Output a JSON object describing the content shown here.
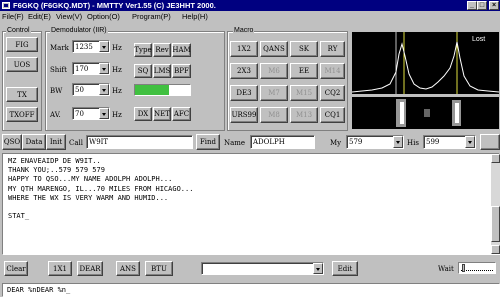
{
  "window": {
    "title": "F6GKQ (F6GKQ.MDT) - MMTTY Ver1.55 (C) JE3HHT 2000."
  },
  "menu": [
    "File(F)",
    "Edit(E)",
    "View(V)",
    "Option(O)",
    "Program(P)",
    "Help(H)"
  ],
  "control": {
    "group_label": "Control",
    "buttons": [
      "FIG",
      "UOS",
      "TX",
      "TXOFF"
    ]
  },
  "demodulator": {
    "group_label": "Demodulator (IIR)",
    "rows": [
      {
        "label": "Mark",
        "value": "1235",
        "unit": "Hz"
      },
      {
        "label": "Shift",
        "value": "170",
        "unit": "Hz"
      },
      {
        "label": "BW",
        "value": "50",
        "unit": "Hz"
      },
      {
        "label": "AV.",
        "value": "70",
        "unit": "Hz"
      }
    ],
    "buttons_row1": [
      "Type",
      "Rev",
      "HAM"
    ],
    "buttons_row2": [
      "SQ",
      "LMS",
      "BPF"
    ],
    "buttons_row4": [
      "DX",
      "NET",
      "AFC"
    ],
    "level_fraction": 0.62,
    "level_color": "#40c040"
  },
  "macro": {
    "group_label": "Macro",
    "rows": [
      [
        {
          "label": "1X2",
          "gray": false
        },
        {
          "label": "QANS",
          "gray": false
        },
        {
          "label": "SK",
          "gray": false
        },
        {
          "label": "RY",
          "gray": false
        }
      ],
      [
        {
          "label": "2X3",
          "gray": false
        },
        {
          "label": "M6",
          "gray": true
        },
        {
          "label": "EE",
          "gray": false
        },
        {
          "label": "M14",
          "gray": true
        }
      ],
      [
        {
          "label": "DE3",
          "gray": false
        },
        {
          "label": "M7",
          "gray": true
        },
        {
          "label": "M15",
          "gray": true
        },
        {
          "label": "CQ2",
          "gray": false
        }
      ],
      [
        {
          "label": "URS99",
          "gray": false
        },
        {
          "label": "M8",
          "gray": true
        },
        {
          "label": "M13",
          "gray": true
        },
        {
          "label": "CQ1",
          "gray": false
        }
      ]
    ]
  },
  "spectrum": {
    "lost_label": "Lost"
  },
  "callbar": {
    "qso_label": "QSO",
    "data_label": "Data",
    "init_label": "Init",
    "call_label": "Call",
    "call_value": "W9IT",
    "find_label": "Find",
    "name_label": "Name",
    "name_value": "ADOLPH",
    "my_label": "My",
    "my_value": "579",
    "his_label": "His",
    "his_value": "599"
  },
  "receive": {
    "lines": [
      "MZ ENAVEAIDP DE W9IT..",
      "THANK YOU;..579 579 579",
      "HAPPY TO QSO...MY NAME ADOLPH ADOLPH...",
      "MY QTH MARENGO, IL...70 MILES FROM HICAGO...",
      "WHERE THE WX IS VERY WARM AND HUMID...",
      "",
      "STAT_"
    ]
  },
  "bottombar": {
    "buttons": [
      "Clear",
      "1X1",
      "DEAR",
      "ANS",
      "BTU"
    ],
    "edit_label": "Edit",
    "wait_label": "Wait"
  },
  "transmit": {
    "text": "DEAR %nDEAR %n_"
  }
}
